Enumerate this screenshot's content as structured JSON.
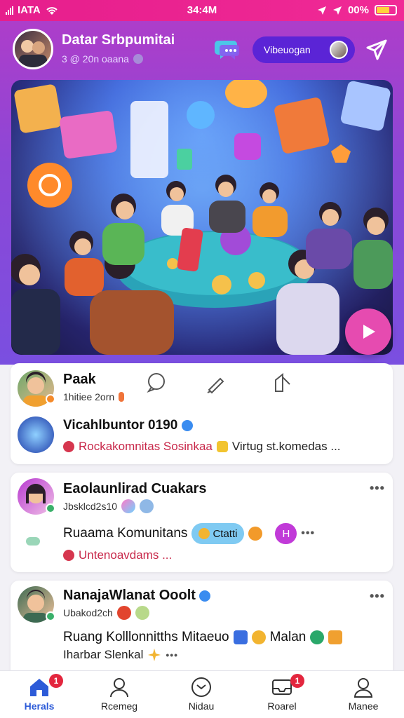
{
  "status_bar": {
    "carrier": "IATA",
    "time": "34:4M",
    "battery": "00%"
  },
  "header": {
    "title": "Datar Srbpumitai",
    "subtitle": "3 @ 20n oaana",
    "pill_label": "Vibeuogan"
  },
  "hero": {
    "play_label": "play"
  },
  "cards": [
    {
      "name": "Paak",
      "meta": "1hitiee 2orn",
      "sub_name": "Vicahlbuntor 0190",
      "line": "Rockakomnitas Sosinkaa",
      "line2": "Virtug st.komedas ..."
    },
    {
      "name": "Eaolaunlirad Cuakars",
      "meta": "Jbsklcd2s10",
      "line1": "Ruaama Komunitans",
      "chip1": "Ctatti",
      "chip2": "H",
      "line2": "Untenoavdams ..."
    },
    {
      "name": "NanajaWlanat Ooolt",
      "meta": "Ubakod2ch",
      "line1": "Ruang Kolllonnitths Mitaeuo",
      "line1b": "Malan",
      "line2": "Iharbar Slenkal"
    }
  ],
  "tabs": [
    {
      "label": "Herals",
      "badge": "1"
    },
    {
      "label": "Rcemeg"
    },
    {
      "label": "Nidau"
    },
    {
      "label": "Roarel",
      "badge": "1"
    },
    {
      "label": "Manee"
    }
  ],
  "colors": {
    "status_bar": "#f02a96",
    "header_gradient_start": "#b23cc8",
    "header_gradient_end": "#7a4fe0",
    "accent_blue": "#2d5bd8",
    "play": "#e64bb0",
    "badge": "#e3263e",
    "pill": "#5b24d6"
  }
}
